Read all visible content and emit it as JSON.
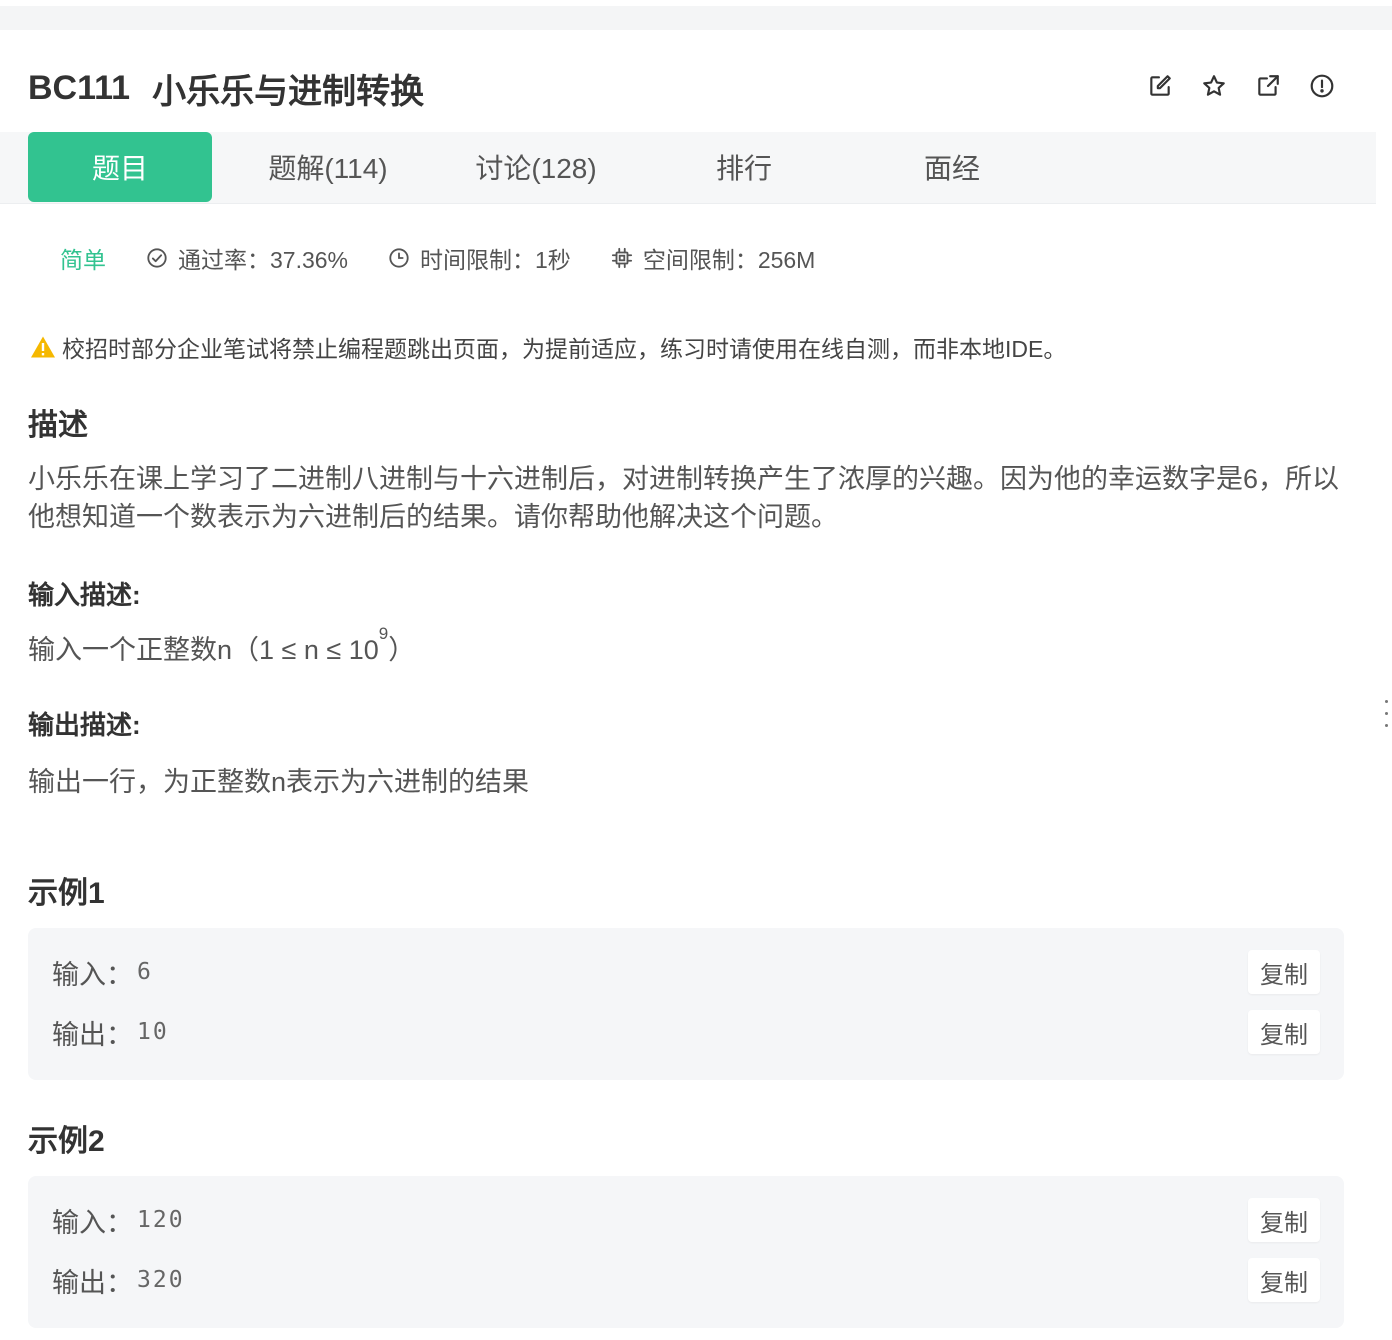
{
  "problem": {
    "id": "BC111",
    "name": "小乐乐与进制转换"
  },
  "actions": [
    {
      "icon": "edit-icon"
    },
    {
      "icon": "star-icon"
    },
    {
      "icon": "external-link-icon"
    },
    {
      "icon": "report-icon"
    }
  ],
  "tabs": [
    {
      "label": "题目",
      "active": true
    },
    {
      "label": "题解(114)"
    },
    {
      "label": "讨论(128)"
    },
    {
      "label": "排行"
    },
    {
      "label": "面经"
    }
  ],
  "meta": {
    "difficulty": "简单",
    "pass_rate": "通过率：37.36%",
    "time_limit": "时间限制：1秒",
    "memory_limit": "空间限制：256M"
  },
  "notice": "校招时部分企业笔试将禁止编程题跳出页面，为提前适应，练习时请使用在线自测，而非本地IDE。",
  "description": {
    "heading": "描述",
    "text": "小乐乐在课上学习了二进制八进制与十六进制后，对进制转换产生了浓厚的兴趣。因为他的幸运数字是6，所以他想知道一个数表示为六进制后的结果。请你帮助他解决这个问题。"
  },
  "input_desc": {
    "heading": "输入描述:",
    "text": "输入一个正整数n（1 ≤ n ≤ 10",
    "sup": "9",
    "tail": "）"
  },
  "output_desc": {
    "heading": "输出描述:",
    "text": "输出一行，为正整数n表示为六进制的结果"
  },
  "examples": [
    {
      "heading": "示例1",
      "input_label": "输入：",
      "input": "6",
      "output_label": "输出：",
      "output": "10",
      "copy": "复制"
    },
    {
      "heading": "示例2",
      "input_label": "输入：",
      "input": "120",
      "output_label": "输出：",
      "output": "320",
      "copy": "复制"
    }
  ],
  "colors": {
    "accent": "#32c390",
    "warning": "#f5b800"
  }
}
